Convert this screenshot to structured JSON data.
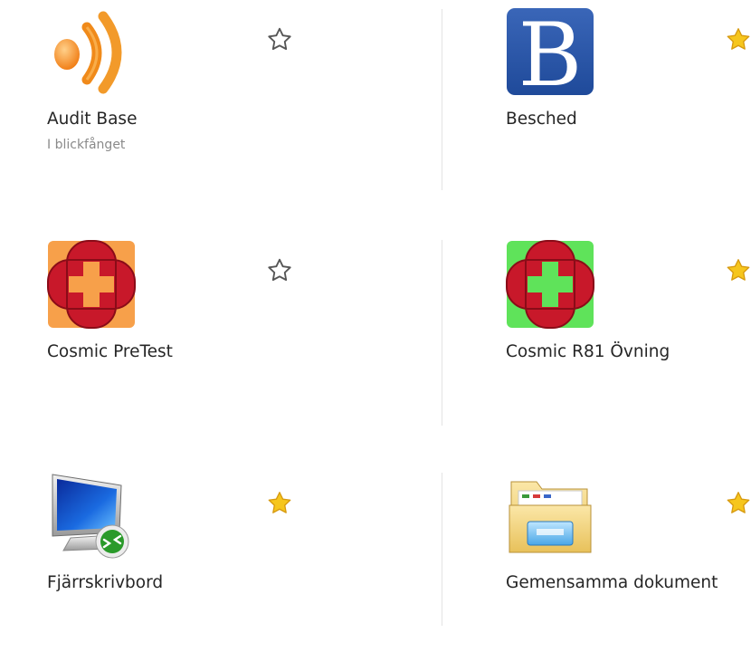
{
  "apps": [
    {
      "name": "Audit Base",
      "subtitle": "I blickfånget",
      "icon": "audit-base-icon",
      "favorite": false
    },
    {
      "name": "Besched",
      "subtitle": "",
      "icon": "besched-icon",
      "favorite": true
    },
    {
      "name": "Cosmic PreTest",
      "subtitle": "",
      "icon": "cosmic-pretest-icon",
      "favorite": false
    },
    {
      "name": "Cosmic R81 Övning",
      "subtitle": "",
      "icon": "cosmic-r81-icon",
      "favorite": true
    },
    {
      "name": "Fjärrskrivbord",
      "subtitle": "",
      "icon": "remote-desktop-icon",
      "favorite": true
    },
    {
      "name": "Gemensamma dokument",
      "subtitle": "",
      "icon": "shared-folder-icon",
      "favorite": true
    }
  ],
  "colors": {
    "star_filled": "#f6c61d",
    "star_outline": "#555555",
    "label": "#262626",
    "sublabel": "#8a8a8a",
    "divider": "#e3e3e3"
  }
}
